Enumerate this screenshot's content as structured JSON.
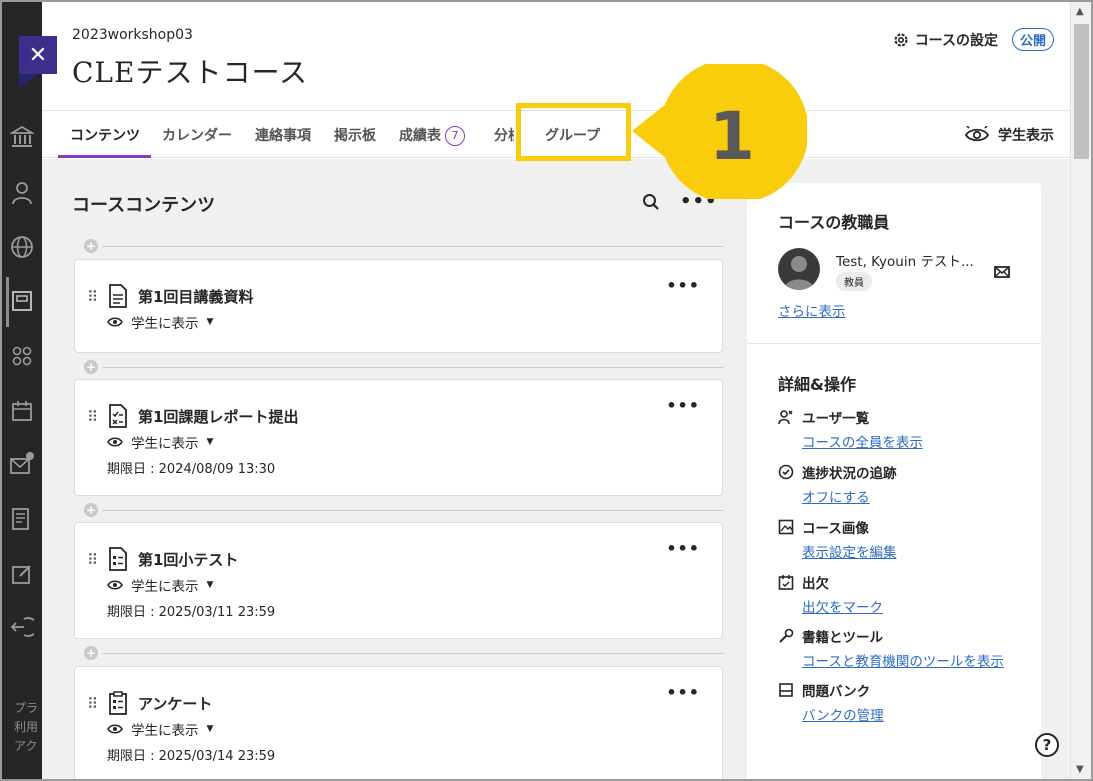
{
  "header": {
    "course_id": "2023workshop03",
    "course_title": "CLEテストコース",
    "settings_label": "コースの設定",
    "publish_badge": "公開"
  },
  "tabs": [
    {
      "label": "コンテンツ",
      "active": true
    },
    {
      "label": "カレンダー"
    },
    {
      "label": "連絡事項"
    },
    {
      "label": "掲示板"
    },
    {
      "label": "成績表",
      "badge": "7"
    },
    {
      "label": "分析"
    },
    {
      "label": "グループ"
    }
  ],
  "student_view_label": "学生表示",
  "annotation": {
    "number": "1",
    "color": "#f9cd0c"
  },
  "content": {
    "title": "コースコンテンツ",
    "items": [
      {
        "title": "第1回目講義資料",
        "visibility": "学生に表示",
        "icon": "document-icon"
      },
      {
        "title": "第1回課題レポート提出",
        "visibility": "学生に表示",
        "due": "期限日 : 2024/08/09 13:30",
        "icon": "assignment-icon"
      },
      {
        "title": "第1回小テスト",
        "visibility": "学生に表示",
        "due": "期限日 : 2025/03/11 23:59",
        "icon": "test-icon"
      },
      {
        "title": "アンケート",
        "visibility": "学生に表示",
        "due": "期限日 : 2025/03/14 23:59",
        "icon": "survey-icon"
      }
    ]
  },
  "panel": {
    "staff_title": "コースの教職員",
    "instructor_name": "Test, Kyouin テスト...",
    "instructor_role": "教員",
    "show_more": "さらに表示",
    "ops_title": "詳細&操作",
    "ops": [
      {
        "title": "ユーザ一覧",
        "link": "コースの全員を表示",
        "icon": "users-icon"
      },
      {
        "title": "進捗状況の追跡",
        "link": "オフにする",
        "icon": "check-circle-icon"
      },
      {
        "title": "コース画像",
        "link": "表示設定を編集",
        "icon": "image-icon"
      },
      {
        "title": "出欠",
        "link": "出欠をマーク",
        "icon": "attendance-icon"
      },
      {
        "title": "書籍とツール",
        "link": "コースと教育機関のツールを表示",
        "icon": "wrench-icon"
      },
      {
        "title": "問題バンク",
        "link": "バンクの管理",
        "icon": "bank-icon"
      }
    ]
  },
  "leftnav_footer": [
    "プラ",
    "利用",
    "アク"
  ],
  "help_label": "?"
}
